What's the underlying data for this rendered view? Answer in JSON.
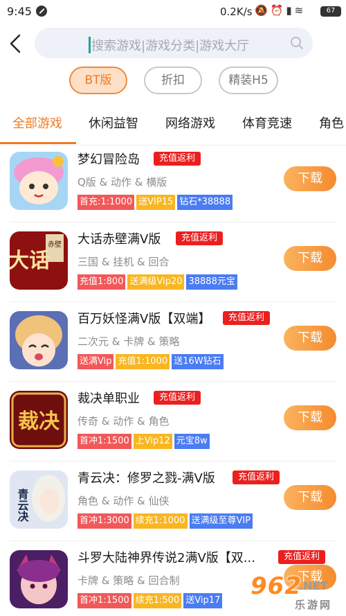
{
  "status_bar": {
    "time": "9:45",
    "net_speed": "0.2K/s",
    "battery": "67",
    "icons": [
      "do-not-disturb-icon",
      "mute-icon",
      "alarm-icon",
      "signal-icon",
      "wifi-icon"
    ]
  },
  "search": {
    "placeholder": "搜索游戏|游戏分类|游戏大厅"
  },
  "filters": [
    {
      "label": "BT版",
      "active": true
    },
    {
      "label": "折扣",
      "active": false
    },
    {
      "label": "精装H5",
      "active": false
    }
  ],
  "tabs": [
    {
      "label": "全部游戏",
      "active": true
    },
    {
      "label": "休闲益智",
      "active": false
    },
    {
      "label": "网络游戏",
      "active": false
    },
    {
      "label": "体育竞速",
      "active": false
    },
    {
      "label": "角色",
      "active": false
    }
  ],
  "games": [
    {
      "name": "梦幻冒险岛",
      "rebate": "充值返利",
      "tags": "Q版 & 动作 & 横版",
      "badges": [
        "首充:1:1000",
        "送VIP15",
        "钻石*38888"
      ],
      "download": "下载"
    },
    {
      "name": "大话赤壁满V版",
      "rebate": "充值返利",
      "tags": "三国 & 挂机 & 回合",
      "badges": [
        "充值1:800",
        "送满级Vip20",
        "38888元宝"
      ],
      "download": "下载"
    },
    {
      "name": "百万妖怪满V版【双端】",
      "rebate": "充值返利",
      "tags": "二次元 & 卡牌 & 策略",
      "badges": [
        "送满Vip",
        "充值1:1000",
        "送16W钻石"
      ],
      "download": "下载"
    },
    {
      "name": "裁决单职业",
      "rebate": "充值返利",
      "tags": "传奇 & 动作 & 角色",
      "badges": [
        "首冲1:1500",
        "上Vip12",
        "元宝8w"
      ],
      "download": "下载"
    },
    {
      "name": "青云决：修罗之戮-满V版",
      "rebate": "充值返利",
      "tags": "角色 & 动作 & 仙侠",
      "badges": [
        "首冲1:3000",
        "续充1:1000",
        "送满级至尊VIP"
      ],
      "download": "下载"
    },
    {
      "name": "斗罗大陆神界传说2满V版【双...",
      "rebate": "充值返利",
      "tags": "卡牌 & 策略 & 回合制",
      "badges": [
        "首冲1:1500",
        "续充1:500",
        "送Vip17"
      ],
      "download": "下载"
    }
  ],
  "icon_art": {
    "game_1": "赤壁",
    "game_2": "大话",
    "game_4": "裁决",
    "game_5": "青云决"
  },
  "watermark": {
    "logo": "962",
    "net": ".NET",
    "sub": "乐游网"
  },
  "colors": {
    "accent": "#f07a22",
    "rebate": "#ec1f1f",
    "badge_red": "#f25858",
    "badge_yellow": "#f9b621",
    "badge_blue": "#4a7cf2",
    "search_bg": "#eef1f7"
  }
}
